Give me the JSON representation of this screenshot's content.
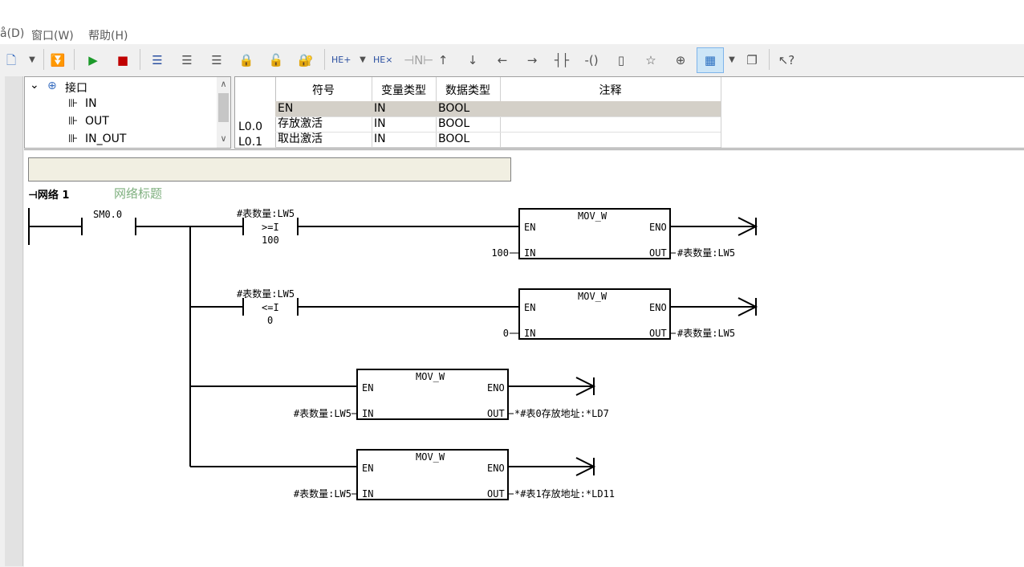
{
  "menu": {
    "partial": "å(D)",
    "window": "窗口(W)",
    "help": "帮助(H)"
  },
  "toolbar": {
    "icons": [
      "new-file-icon",
      "download-icon",
      "run-icon",
      "stop-icon",
      "block1-icon",
      "block2-icon",
      "block3-icon",
      "lock-icon",
      "unlock-icon",
      "lock-blue-icon",
      "insert-network-icon",
      "delete-network-icon",
      "negate-icon",
      "up-arrow-icon",
      "down-arrow-icon",
      "left-arrow-icon",
      "right-arrow-icon",
      "contact-icon",
      "coil-icon",
      "box-icon",
      "star-icon",
      "zoom-icon",
      "table-icon",
      "windows-icon",
      "help-icon"
    ]
  },
  "tree": {
    "root": "接口",
    "items": [
      "IN",
      "OUT",
      "IN_OUT"
    ]
  },
  "vartable": {
    "headers": [
      "符号",
      "变量类型",
      "数据类型",
      "注释"
    ],
    "rownums": [
      "",
      "L0.0",
      "L0.1"
    ],
    "rows": [
      {
        "symbol": "EN",
        "vartype": "IN",
        "datatype": "BOOL",
        "comment": ""
      },
      {
        "symbol": "存放激活",
        "vartype": "IN",
        "datatype": "BOOL",
        "comment": ""
      },
      {
        "symbol": "取出激活",
        "vartype": "IN",
        "datatype": "BOOL",
        "comment": ""
      }
    ]
  },
  "network": {
    "title": "网络 1",
    "subtitle": "网络标题",
    "contact_sm": "SM0.0",
    "cmp1": {
      "operand": "#表数量:LW5",
      "op": ">=I",
      "value": "100"
    },
    "cmp2": {
      "operand": "#表数量:LW5",
      "op": "<=I",
      "value": "0"
    },
    "boxes": [
      {
        "name": "MOV_W",
        "en": "EN",
        "eno": "ENO",
        "in_pin": "IN",
        "out_pin": "OUT",
        "in_val": "100",
        "out_val": "#表数量:LW5"
      },
      {
        "name": "MOV_W",
        "en": "EN",
        "eno": "ENO",
        "in_pin": "IN",
        "out_pin": "OUT",
        "in_val": "0",
        "out_val": "#表数量:LW5"
      },
      {
        "name": "MOV_W",
        "en": "EN",
        "eno": "ENO",
        "in_pin": "IN",
        "out_pin": "OUT",
        "in_val": "#表数量:LW5",
        "out_val": "*#表0存放地址:*LD7"
      },
      {
        "name": "MOV_W",
        "en": "EN",
        "eno": "ENO",
        "in_pin": "IN",
        "out_pin": "OUT",
        "in_val": "#表数量:LW5",
        "out_val": "*#表1存放地址:*LD11"
      }
    ]
  }
}
